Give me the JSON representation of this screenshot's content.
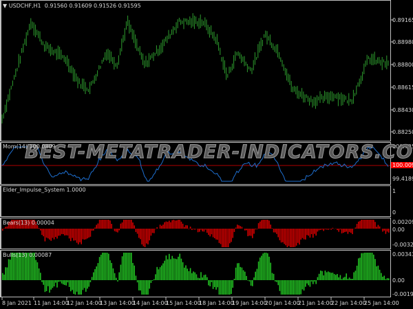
{
  "header": {
    "symbol": "USDCHF,H1",
    "ohlc": "0.91560 0.91609 0.91526 0.91595"
  },
  "watermark": "BEST-METATRADER-INDICATORS.COM",
  "colors": {
    "bull_candle": "#2e9e2e",
    "momentum": "#1e6fd0",
    "mom_level": "#b00000",
    "bears": "#d00000",
    "bulls": "#22c022",
    "current_label": "#ff0000"
  },
  "main": {
    "price_axis": [
      "0.89165",
      "0.88980",
      "0.88800",
      "0.88615",
      "0.88430",
      "0.88250"
    ]
  },
  "mom": {
    "label": "Mom(14) 100.0809",
    "axis": [
      "100.7256",
      "99.4189"
    ],
    "current": "100.0096"
  },
  "elder": {
    "label": "Elder_Impulse_System 1.0000",
    "axis": [
      "1",
      "0"
    ]
  },
  "bears": {
    "label": "Bears(13) 0.00004",
    "axis": [
      "0.00209",
      "0.00",
      "-0.00324"
    ]
  },
  "bulls": {
    "label": "Bulls(13) 0.00087",
    "axis": [
      "0.00343",
      "0.00",
      "-0.00196"
    ]
  },
  "time_axis": [
    "8 Jan 2021",
    "11 Jan 14:00",
    "12 Jan 14:00",
    "13 Jan 14:00",
    "14 Jan 14:00",
    "15 Jan 14:00",
    "18 Jan 14:00",
    "19 Jan 14:00",
    "20 Jan 14:00",
    "21 Jan 14:00",
    "22 Jan 14:00",
    "25 Jan 14:00"
  ],
  "chart_data": {
    "type": "line",
    "series": [
      {
        "values": [
          [
            0.883,
            0
          ],
          [
            0.8915,
            45
          ],
          [
            0.8895,
            65
          ],
          [
            0.8885,
            95
          ],
          [
            0.8865,
            115
          ],
          [
            0.886,
            130
          ],
          [
            0.889,
            155
          ],
          [
            0.888,
            170
          ],
          [
            0.8915,
            185
          ],
          [
            0.888,
            210
          ],
          [
            0.8895,
            235
          ],
          [
            0.8915,
            260
          ],
          [
            0.8915,
            295
          ],
          [
            0.89,
            315
          ],
          [
            0.887,
            330
          ],
          [
            0.889,
            345
          ],
          [
            0.8875,
            365
          ],
          [
            0.8905,
            385
          ],
          [
            0.889,
            405
          ],
          [
            0.886,
            425
          ],
          [
            0.885,
            455
          ],
          [
            0.8855,
            485
          ],
          [
            0.885,
            510
          ],
          [
            0.887,
            525
          ],
          [
            0.8885,
            535
          ],
          [
            0.888,
            565
          ]
        ]
      }
    ]
  }
}
